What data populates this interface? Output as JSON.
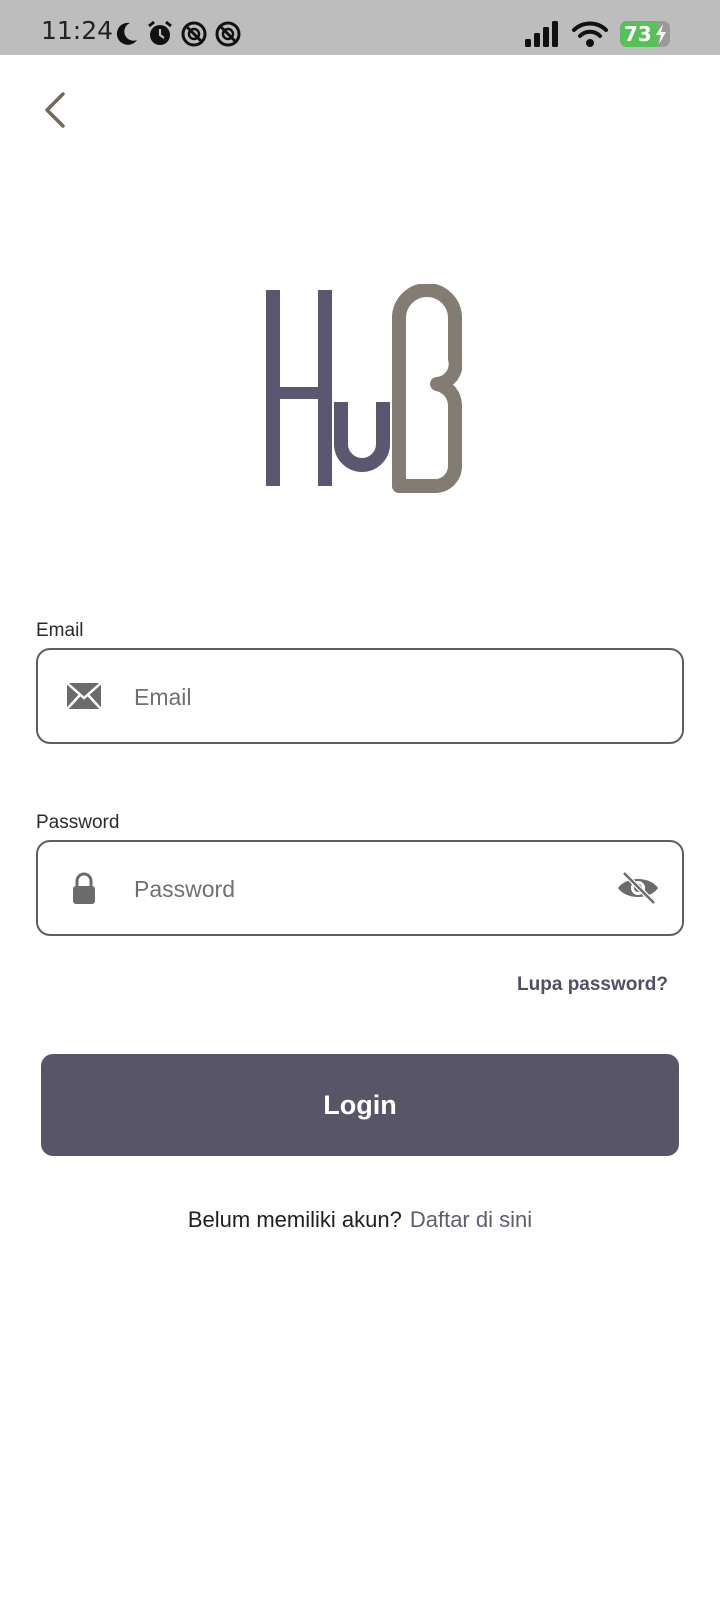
{
  "status_bar": {
    "time": "11:24",
    "battery": "73",
    "icons_left": [
      "moon-icon",
      "alarm-icon",
      "no-sign-icon",
      "no-sign-icon"
    ],
    "icons_right": [
      "signal-icon",
      "wifi-icon",
      "battery-icon"
    ]
  },
  "nav": {
    "back_icon": "chevron-left-icon"
  },
  "brand": {
    "logo_text": "HUB"
  },
  "form": {
    "email": {
      "label": "Email",
      "placeholder": "Email",
      "value": "",
      "icon": "mail-icon"
    },
    "password": {
      "label": "Password",
      "placeholder": "Password",
      "value": "",
      "icon": "lock-icon",
      "toggle_icon": "eye-off-icon"
    },
    "forgot_label": "Lupa password?",
    "login_label": "Login",
    "signup_prompt": "Belum memiliki akun?",
    "signup_link": "Daftar di sini"
  },
  "colors": {
    "primary": "#585569",
    "logo_left": "#5a5870",
    "logo_right": "#847c72",
    "status_bar": "#bdbdbd",
    "battery": "#54c254"
  }
}
